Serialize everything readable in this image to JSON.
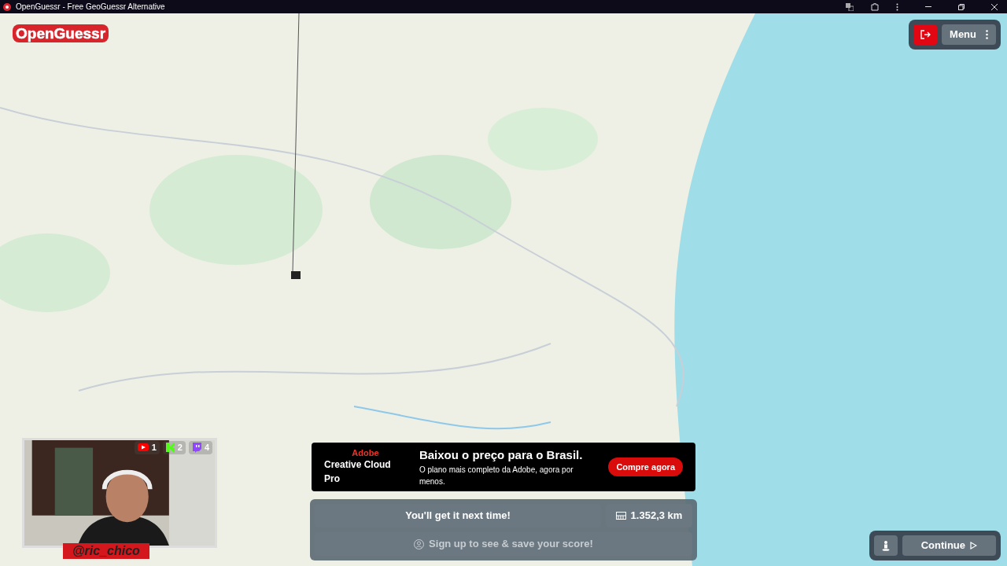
{
  "window": {
    "title": "OpenGuessr - Free GeoGuessr Alternative"
  },
  "logo": "OpenGuessr",
  "menu": {
    "label": "Menu"
  },
  "ad": {
    "brand": "Adobe",
    "product": "Creative Cloud Pro",
    "headline": "Baixou o preço para o Brasil.",
    "subline": "O plano mais completo da Adobe, agora por menos.",
    "cta": "Compre agora"
  },
  "result": {
    "message": "You'll get it next time!",
    "distance": "1.352,3 km",
    "signup": "Sign up to see & save your score!"
  },
  "continue": {
    "label": "Continue"
  },
  "stream": {
    "counts": [
      {
        "kind": "youtube",
        "value": "1",
        "color": "#ff0000"
      },
      {
        "kind": "kick",
        "value": "2",
        "color": "#53fc18"
      },
      {
        "kind": "twitch",
        "value": "4",
        "color": "#9146ff"
      }
    ],
    "handle": "@ric_chico"
  }
}
